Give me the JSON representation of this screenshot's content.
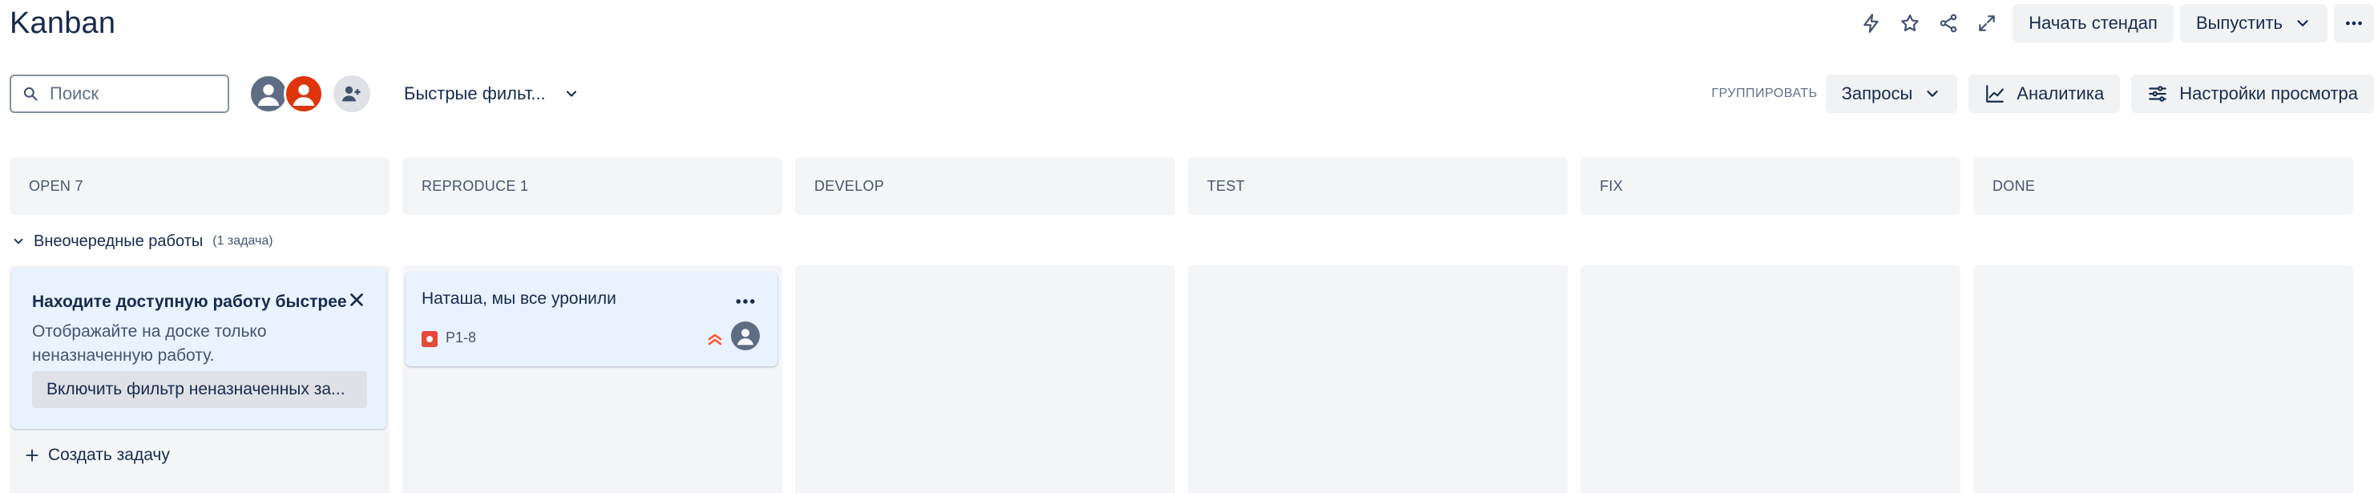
{
  "board": {
    "title": "Kanban"
  },
  "header": {
    "start_standup": "Начать стендап",
    "release": "Выпустить"
  },
  "toolbar": {
    "search_placeholder": "Поиск",
    "quick_filters": "Быстрые фильт...",
    "group_label": "ГРУППИРОВАТЬ",
    "group_value": "Запросы",
    "analytics": "Аналитика",
    "view_settings": "Настройки просмотра"
  },
  "columns": [
    {
      "label": "OPEN 7"
    },
    {
      "label": "REPRODUCE 1"
    },
    {
      "label": "DEVELOP"
    },
    {
      "label": "TEST"
    },
    {
      "label": "FIX"
    },
    {
      "label": "DONE"
    }
  ],
  "swimlane": {
    "label": "Внеочередные работы",
    "count": "(1 задача)"
  },
  "tip": {
    "title": "Находите доступную работу быстрее",
    "text": "Отображайте на доске только неназначенную работу.",
    "button": "Включить фильтр неназначенных за..."
  },
  "create_task": "Создать задачу",
  "card": {
    "title": "Наташа, мы все уронили",
    "key": "P1-8",
    "type_color": "#e5493a",
    "priority_color": "#ff5630"
  },
  "icons": [
    "lightning-icon",
    "star-icon",
    "share-icon",
    "expand-icon",
    "more-icon",
    "search-icon",
    "chevron-down-icon",
    "add-person-icon",
    "chart-icon",
    "settings-sliders-icon",
    "close-icon",
    "plus-icon",
    "priority-high-icon",
    "bug-icon"
  ]
}
